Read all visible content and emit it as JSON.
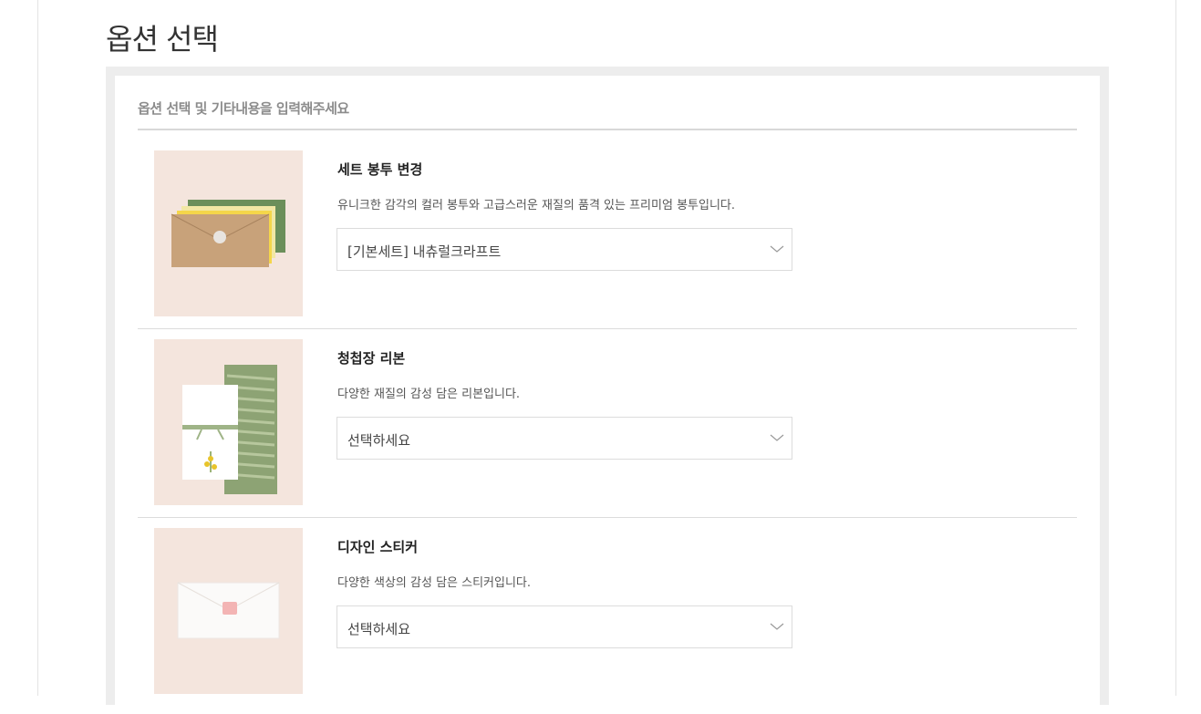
{
  "page": {
    "title": "옵션 선택"
  },
  "options_panel": {
    "header": "옵션 선택 및 기타내용을 입력해주세요",
    "items": [
      {
        "title": "세트 봉투 변경",
        "description": "유니크한 감각의 컬러 봉투와 고급스러운 재질의 품격 있는 프리미엄 봉투입니다.",
        "selected_value": "[기본세트] 내츄럴크라프트",
        "image_icon": "envelope-set-image"
      },
      {
        "title": "청첩장 리본",
        "description": "다양한 재질의 감성 담은 리본입니다.",
        "selected_value": "선택하세요",
        "image_icon": "ribbon-invitation-image"
      },
      {
        "title": "디자인 스티커",
        "description": "다양한 색상의 감성 담은 스티커입니다.",
        "selected_value": "선택하세요",
        "image_icon": "sticker-envelope-image"
      }
    ]
  },
  "colors": {
    "thumbnail_background": "#f4e5dd",
    "panel_border": "#ededed",
    "divider": "#dcdcdc"
  }
}
